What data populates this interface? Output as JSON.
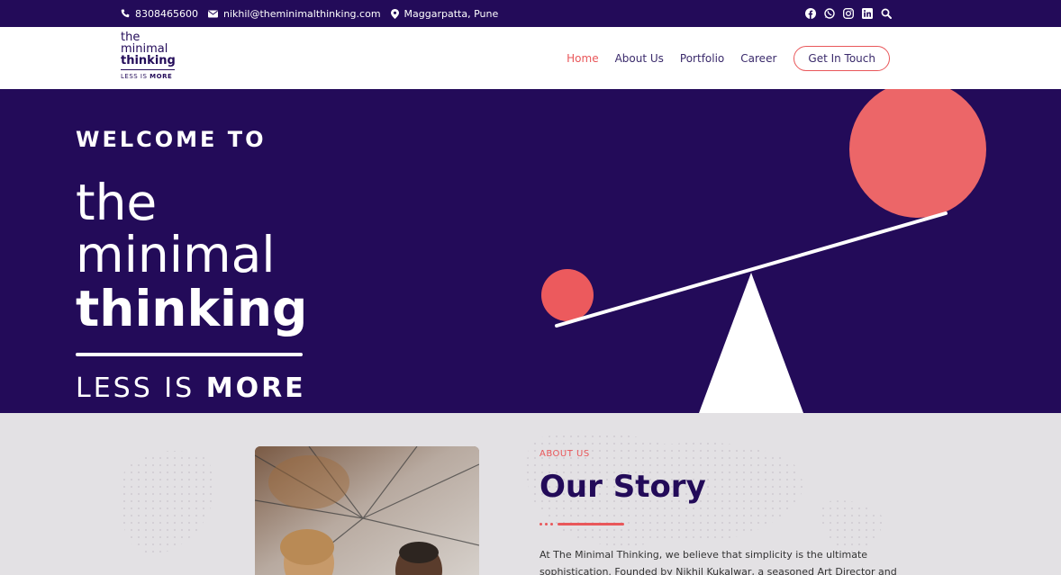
{
  "topbar": {
    "phone": "8308465600",
    "email": "nikhil@theminimalthinking.com",
    "location": "Maggarpatta, Pune",
    "social_icons": [
      "facebook-icon",
      "whatsapp-icon",
      "instagram-icon",
      "linkedin-icon",
      "search-icon"
    ]
  },
  "logo": {
    "line1": "the",
    "line2": "minimal",
    "line3": "thinking",
    "tagline_light": "LESS IS ",
    "tagline_bold": "MORE"
  },
  "nav": {
    "items": [
      {
        "label": "Home",
        "active": true
      },
      {
        "label": "About Us",
        "active": false
      },
      {
        "label": "Portfolio",
        "active": false
      },
      {
        "label": "Career",
        "active": false
      }
    ],
    "cta_label": "Get In Touch"
  },
  "hero": {
    "welcome": "WELCOME TO",
    "line1": "the",
    "line2": "minimal",
    "line3": "thinking",
    "tagline_light": "LESS IS ",
    "tagline_bold": "MORE"
  },
  "about": {
    "label": "ABOUT US",
    "title": "Our Story",
    "body": "At The Minimal Thinking, we believe that simplicity is the ultimate sophistication. Founded by Nikhil Kukalwar, a seasoned Art Director and UI/UX"
  },
  "colors": {
    "brand_purple": "#230b59",
    "accent_coral": "#e9575a",
    "section_gray": "#e3e1e4"
  }
}
